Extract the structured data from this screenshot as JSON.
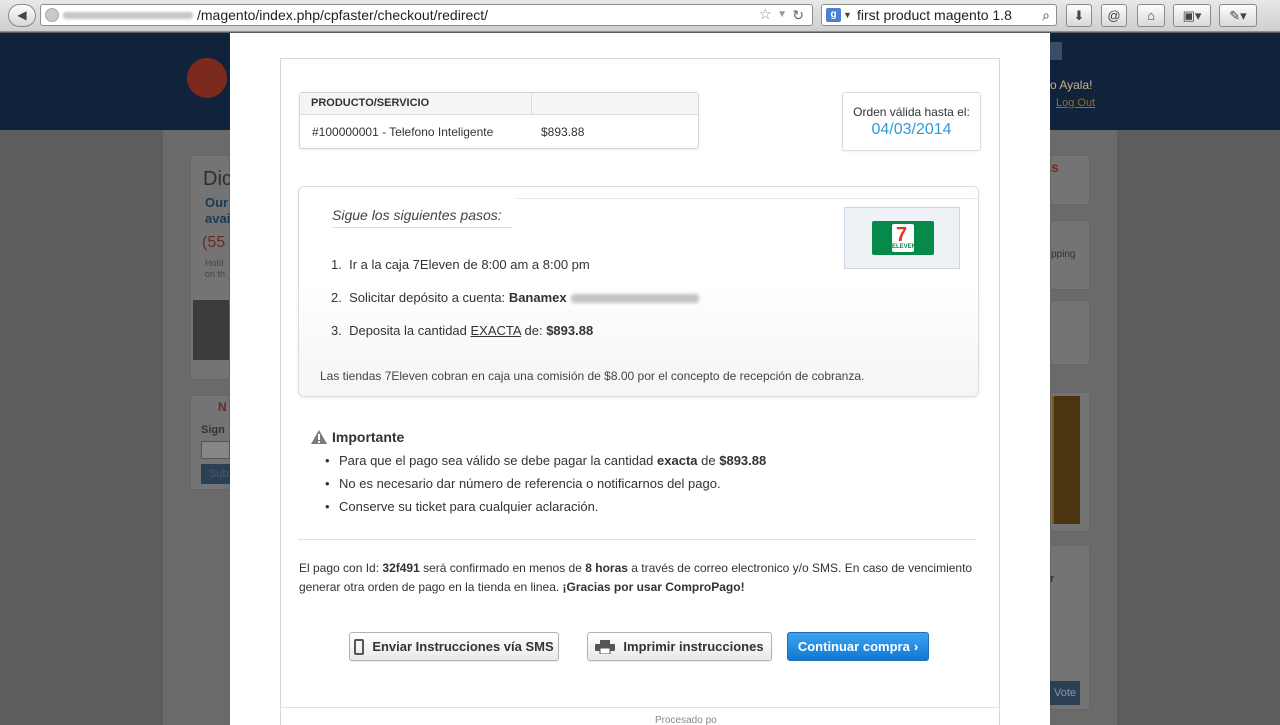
{
  "browser": {
    "url": "/magento/index.php/cpfaster/checkout/redirect/",
    "search_query": "first product magento 1.8"
  },
  "background": {
    "header_user": "o Ayala!",
    "logout": "Log Out",
    "left_heading": "Dic",
    "left_sub1": "Our",
    "left_sub2": "avai",
    "left_number": "(55",
    "left_small1": "Hold",
    "left_small2": "on th",
    "left_n": "N",
    "sign_label": "Sign",
    "sub_button": "Sub",
    "right_s": "s",
    "right_pping": "pping",
    "right_r": "r",
    "vote_button": "Vote"
  },
  "product_table": {
    "header": "PRODUCTO/SERVICIO",
    "item": "#100000001 - Telefono Inteligente",
    "price": "$893.88"
  },
  "order": {
    "label": "Orden válida hasta el:",
    "date": "04/03/2014"
  },
  "steps": {
    "title": "Sigue los siguientes pasos:",
    "step1_num": "1.",
    "step1": "Ir a la caja 7Eleven de 8:00 am a 8:00 pm",
    "step2_num": "2.",
    "step2_text": "Solicitar depósito a cuenta:",
    "step2_bank": "Banamex",
    "step3_num": "3.",
    "step3_text": "Deposita la cantidad",
    "step3_exact": "EXACTA",
    "step3_de": "de:",
    "step3_amount": "$893.88",
    "logo_number": "7",
    "logo_word": "ELEVEN",
    "note": "Las tiendas 7Eleven cobran en caja una comisión de $8.00 por el concepto de recepción de cobranza."
  },
  "important": {
    "title": "Importante",
    "item1_a": "Para que el pago sea válido se debe pagar la cantidad",
    "item1_b": "exacta",
    "item1_c": "de",
    "item1_d": "$893.88",
    "item2": "No es necesario dar número de referencia o notificarnos del pago.",
    "item3": "Conserve su ticket para cualquier aclaración."
  },
  "confirmation": {
    "p1": "El pago con Id:",
    "id": "32f491",
    "p2": "será confirmado en menos de",
    "hours": "8 horas",
    "p3": "a través de correo electronico y/o SMS. En caso de vencimiento generar otra orden de pago en la tienda en linea.",
    "thanks": "¡Gracias por usar ComproPago!"
  },
  "buttons": {
    "sms": "Enviar Instrucciones vía SMS",
    "print": "Imprimir instrucciones",
    "continue": "Continuar compra"
  },
  "footer": {
    "text": "Procesado po"
  }
}
